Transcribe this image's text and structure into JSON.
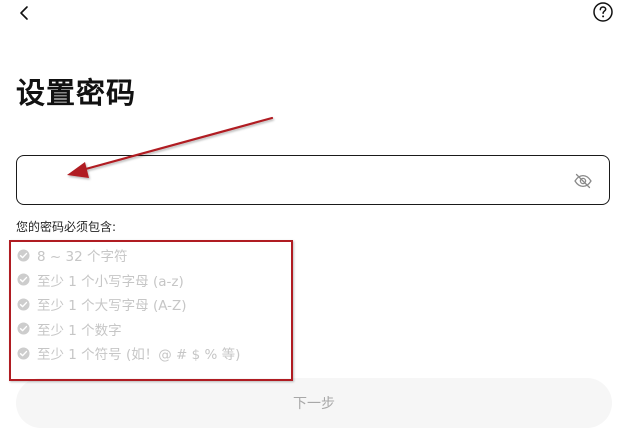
{
  "header": {
    "back_icon": "chevron-left-icon",
    "help_icon": "question-circle-icon"
  },
  "page": {
    "title": "设置密码"
  },
  "password_field": {
    "value": "",
    "placeholder": "",
    "visibility_icon": "eye-off-icon"
  },
  "requirements": {
    "heading": "您的密码必须包含:",
    "items": [
      {
        "label": "8 ~ 32 个字符",
        "met": false
      },
      {
        "label": "至少 1 个小写字母 (a-z)",
        "met": false
      },
      {
        "label": "至少 1 个大写字母 (A-Z)",
        "met": false
      },
      {
        "label": "至少 1 个数字",
        "met": false
      },
      {
        "label": "至少 1 个符号 (如！@ # $ % 等)",
        "met": false
      }
    ]
  },
  "next_button": {
    "label": "下一步",
    "enabled": false
  },
  "colors": {
    "annotation": "#b01c22",
    "requirement_unmet": "#c6c6c6",
    "button_disabled_bg": "#f6f6f6"
  }
}
